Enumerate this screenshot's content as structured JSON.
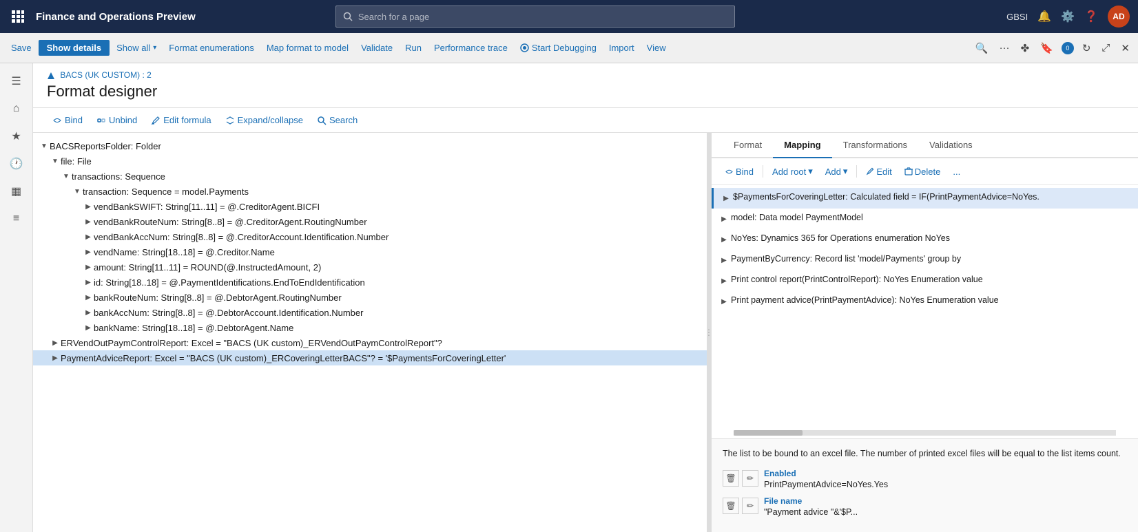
{
  "topNav": {
    "appTitle": "Finance and Operations Preview",
    "searchPlaceholder": "Search for a page",
    "orgLabel": "GBSI",
    "userInitials": "AD",
    "notifCount": "0"
  },
  "toolbar": {
    "saveLabel": "Save",
    "showDetailsLabel": "Show details",
    "showAllLabel": "Show all",
    "formatEnumerationsLabel": "Format enumerations",
    "mapFormatToModelLabel": "Map format to model",
    "validateLabel": "Validate",
    "runLabel": "Run",
    "performanceTraceLabel": "Performance trace",
    "startDebuggingLabel": "Start Debugging",
    "importLabel": "Import",
    "viewLabel": "View"
  },
  "pageHeader": {
    "breadcrumb": "BACS (UK CUSTOM) : 2",
    "title": "Format designer"
  },
  "designerToolbar": {
    "bindLabel": "Bind",
    "unbindLabel": "Unbind",
    "editFormulaLabel": "Edit formula",
    "expandCollapseLabel": "Expand/collapse",
    "searchLabel": "Search"
  },
  "treeItems": [
    {
      "indent": 0,
      "expanded": true,
      "text": "BACSReportsFolder: Folder"
    },
    {
      "indent": 1,
      "expanded": true,
      "text": "file: File"
    },
    {
      "indent": 2,
      "expanded": true,
      "text": "transactions: Sequence"
    },
    {
      "indent": 3,
      "expanded": true,
      "text": "transaction: Sequence = model.Payments"
    },
    {
      "indent": 4,
      "expanded": false,
      "text": "vendBankSWIFT: String[11..11] = @.CreditorAgent.BICFI"
    },
    {
      "indent": 4,
      "expanded": false,
      "text": "vendBankRouteNum: String[8..8] = @.CreditorAgent.RoutingNumber"
    },
    {
      "indent": 4,
      "expanded": false,
      "text": "vendBankAccNum: String[8..8] = @.CreditorAccount.Identification.Number"
    },
    {
      "indent": 4,
      "expanded": false,
      "text": "vendName: String[18..18] = @.Creditor.Name"
    },
    {
      "indent": 4,
      "expanded": false,
      "text": "amount: String[11..11] = ROUND(@.InstructedAmount, 2)"
    },
    {
      "indent": 4,
      "expanded": false,
      "text": "id: String[18..18] = @.PaymentIdentifications.EndToEndIdentification"
    },
    {
      "indent": 4,
      "expanded": false,
      "text": "bankRouteNum: String[8..8] = @.DebtorAgent.RoutingNumber"
    },
    {
      "indent": 4,
      "expanded": false,
      "text": "bankAccNum: String[8..8] = @.DebtorAccount.Identification.Number"
    },
    {
      "indent": 4,
      "expanded": false,
      "text": "bankName: String[18..18] = @.DebtorAgent.Name"
    },
    {
      "indent": 1,
      "expanded": false,
      "text": "ERVendOutPaymControlReport: Excel = \"BACS (UK custom)_ERVendOutPaymControlReport\"?"
    },
    {
      "indent": 1,
      "expanded": false,
      "text": "PaymentAdviceReport: Excel = \"BACS (UK custom)_ERCoveringLetterBACS\"? = '$PaymentsForCoveringLetter'",
      "selected": true
    }
  ],
  "rightTabs": [
    {
      "label": "Format",
      "active": false
    },
    {
      "label": "Mapping",
      "active": true
    },
    {
      "label": "Transformations",
      "active": false
    },
    {
      "label": "Validations",
      "active": false
    }
  ],
  "rightToolbar": {
    "bindLabel": "Bind",
    "addRootLabel": "Add root",
    "addLabel": "Add",
    "editLabel": "Edit",
    "deleteLabel": "Delete",
    "moreLabel": "..."
  },
  "mappingItems": [
    {
      "indent": 0,
      "expanded": false,
      "text": "$PaymentsForCoveringLetter: Calculated field = IF(PrintPaymentAdvice=NoYes.",
      "highlighted": true
    },
    {
      "indent": 0,
      "expanded": false,
      "text": "model: Data model PaymentModel"
    },
    {
      "indent": 0,
      "expanded": false,
      "text": "NoYes: Dynamics 365 for Operations enumeration NoYes"
    },
    {
      "indent": 0,
      "expanded": false,
      "text": "PaymentByCurrency: Record list 'model/Payments' group by"
    },
    {
      "indent": 0,
      "expanded": false,
      "text": "Print control report(PrintControlReport): NoYes Enumeration value"
    },
    {
      "indent": 0,
      "expanded": false,
      "text": "Print payment advice(PrintPaymentAdvice): NoYes Enumeration value"
    }
  ],
  "infoPanel": {
    "infoText": "The list to be bound to an excel file. The number of printed excel files will be equal to the list items count.",
    "properties": [
      {
        "label": "Enabled",
        "value": "PrintPaymentAdvice=NoYes.Yes"
      },
      {
        "label": "File name",
        "value": "\"Payment advice \"&'$P..."
      }
    ]
  }
}
